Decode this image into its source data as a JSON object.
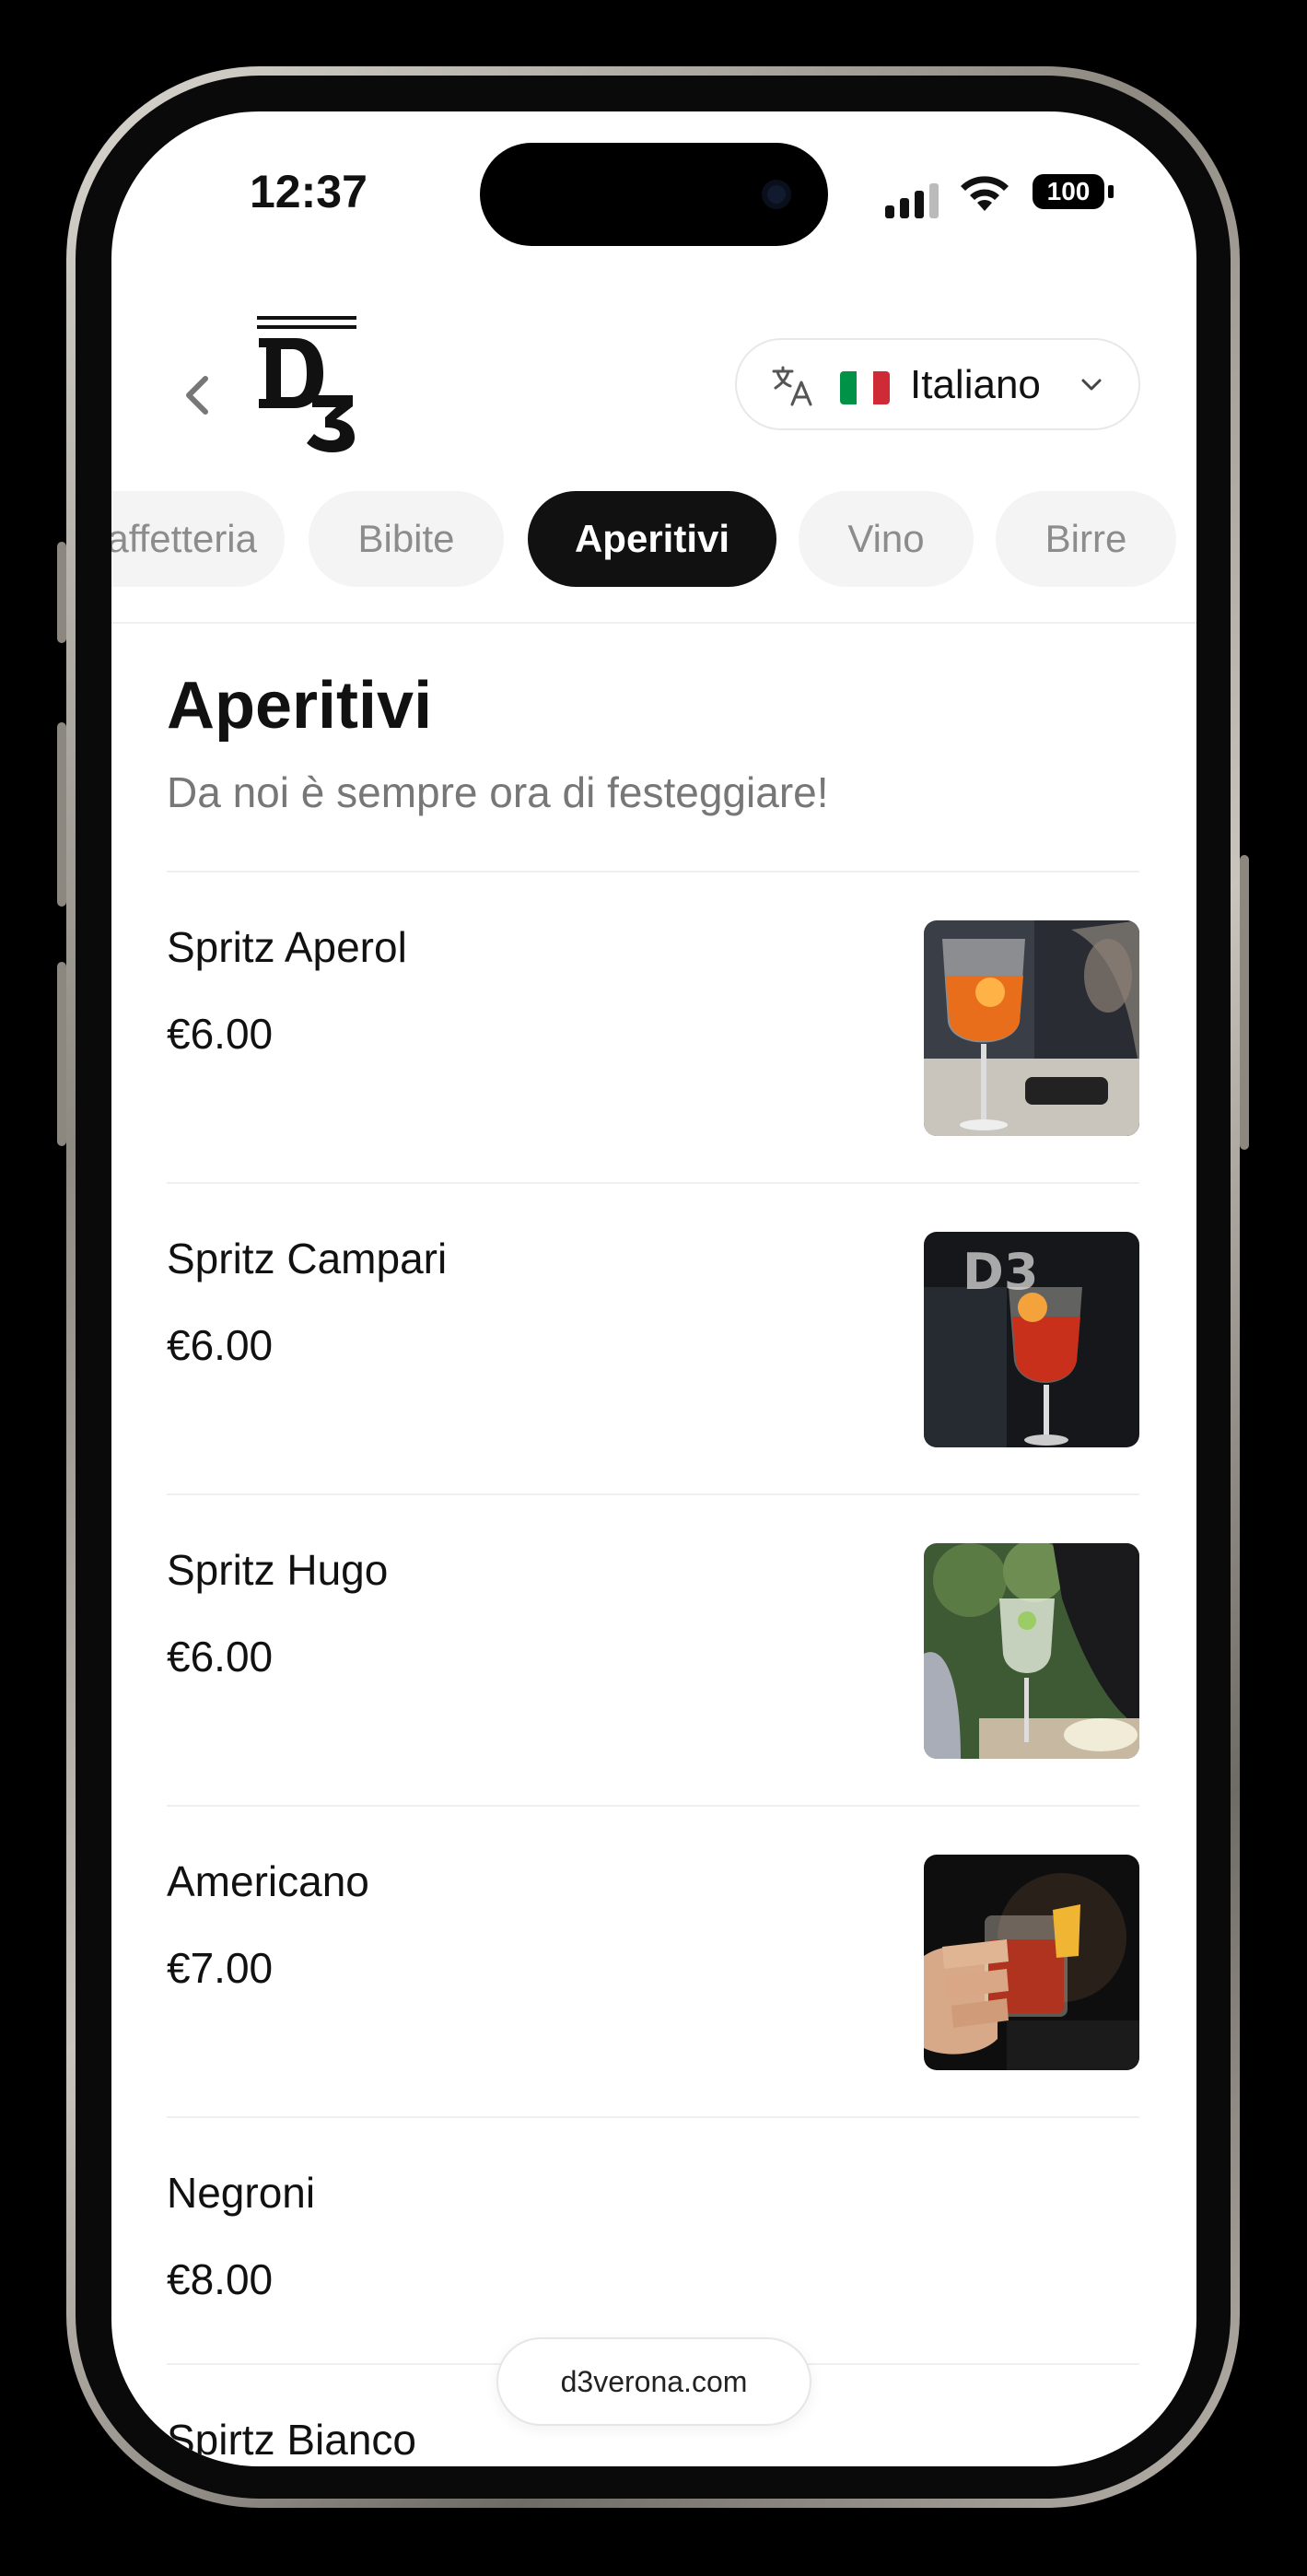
{
  "status_bar": {
    "time": "12:37",
    "battery": "100"
  },
  "header": {
    "language": {
      "label": "Italiano",
      "flag_colors": [
        "#009246",
        "#ffffff",
        "#ce2b37"
      ]
    }
  },
  "categories": [
    {
      "label": "Caffetteria",
      "active": false
    },
    {
      "label": "Bibite",
      "active": false
    },
    {
      "label": "Aperitivi",
      "active": true
    },
    {
      "label": "Vino",
      "active": false
    },
    {
      "label": "Birre",
      "active": false
    }
  ],
  "section": {
    "title": "Aperitivi",
    "subtitle": "Da noi è sempre ora di festeggiare!"
  },
  "items": [
    {
      "name": "Spritz Aperol",
      "price": "€6.00",
      "photo": "spritz-aperol-photo"
    },
    {
      "name": "Spritz Campari",
      "price": "€6.00",
      "photo": "spritz-campari-photo"
    },
    {
      "name": "Spritz Hugo",
      "price": "€6.00",
      "photo": "spritz-hugo-photo"
    },
    {
      "name": "Americano",
      "price": "€7.00",
      "photo": "americano-photo"
    },
    {
      "name": "Negroni",
      "price": "€8.00",
      "photo": null
    },
    {
      "name": "Spirtz Bianco",
      "price": "",
      "photo": null
    }
  ],
  "footer": {
    "url": "d3verona.com"
  }
}
